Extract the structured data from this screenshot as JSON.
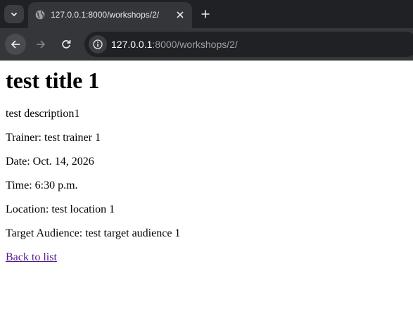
{
  "browser": {
    "tab": {
      "title": "127.0.0.1:8000/workshops/2/"
    },
    "url": {
      "host": "127.0.0.1",
      "rest": ":8000/workshops/2/"
    }
  },
  "workshop": {
    "title": "test title 1",
    "description": "test description1",
    "trainer_label": "Trainer: ",
    "trainer": "test trainer 1",
    "date_label": "Date: ",
    "date": "Oct. 14, 2026",
    "time_label": "Time: ",
    "time": "6:30 p.m.",
    "location_label": "Location: ",
    "location": "test location 1",
    "audience_label": "Target Audience: ",
    "audience": "test target audience 1",
    "back_link": "Back to list"
  },
  "colors": {
    "chrome_dark": "#202124",
    "chrome_toolbar": "#35363a",
    "visited_link": "#551a8b"
  }
}
